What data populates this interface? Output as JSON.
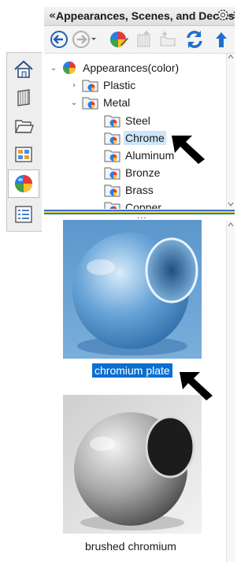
{
  "header": {
    "collapse_glyph": "«",
    "title": "Appearances, Scenes, and Decals",
    "gear_icon": "gear-icon",
    "pin_icon": "pin-icon"
  },
  "toolbar": {
    "buttons": [
      {
        "icon": "back-arrow-icon",
        "enabled": true
      },
      {
        "icon": "forward-arrow-icon",
        "enabled": false
      },
      {
        "icon": "appearance-ball-icon",
        "enabled": true
      },
      {
        "icon": "add-folder-icon",
        "enabled": false
      },
      {
        "icon": "new-folder-icon",
        "enabled": false
      },
      {
        "icon": "refresh-icon",
        "enabled": true
      },
      {
        "icon": "up-arrow-icon",
        "enabled": true
      }
    ]
  },
  "side_tabs": [
    {
      "icon": "home-icon",
      "active": false
    },
    {
      "icon": "parts-icon",
      "active": false
    },
    {
      "icon": "folder-icon",
      "active": false
    },
    {
      "icon": "property-manager-icon",
      "active": false
    },
    {
      "icon": "appearance-ball-icon",
      "active": true
    },
    {
      "icon": "list-icon",
      "active": false
    }
  ],
  "tree": {
    "root": {
      "label": "Appearances(color)",
      "expanded": true
    },
    "items": [
      {
        "label": "Plastic",
        "expanded": false,
        "has_children": true
      },
      {
        "label": "Metal",
        "expanded": true,
        "has_children": true
      },
      {
        "label": "Steel",
        "selected": false
      },
      {
        "label": "Chrome",
        "selected": true
      },
      {
        "label": "Aluminum",
        "selected": false
      },
      {
        "label": "Bronze",
        "selected": false
      },
      {
        "label": "Brass",
        "selected": false
      },
      {
        "label": "Copper",
        "selected": false
      }
    ]
  },
  "gallery": {
    "items": [
      {
        "label": "chromium plate",
        "selected": true
      },
      {
        "label": "brushed chromium",
        "selected": false
      }
    ]
  },
  "colors": {
    "selection_blue": "#0a6fd1",
    "tree_selection": "#cde6f7",
    "splitter_yellow": "#e7df33",
    "splitter_blue": "#3e6fc4"
  }
}
